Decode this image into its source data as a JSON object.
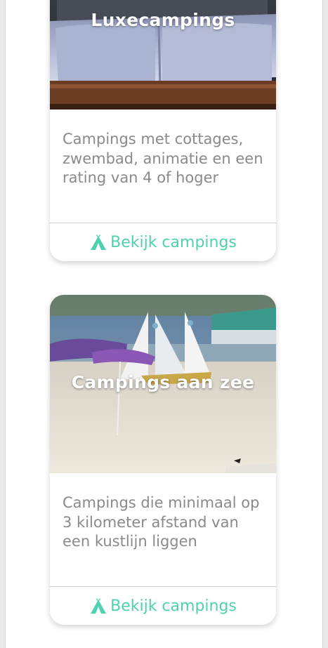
{
  "accent_color": "#4fd1b0",
  "cards": [
    {
      "title": "Luxecampings",
      "description": "Campings met cottages, zwembad, animatie en een rating van 4 of hoger",
      "button_label": "Bekijk campings",
      "button_icon": "tent-icon",
      "image_subject": "luxury-bed-photo"
    },
    {
      "title": "Campings aan zee",
      "description": "Campings die minimaal op 3 kilometer afstand van een kustlijn liggen",
      "button_label": "Bekijk campings",
      "button_icon": "tent-icon",
      "image_subject": "beach-sailboats-photo"
    }
  ]
}
